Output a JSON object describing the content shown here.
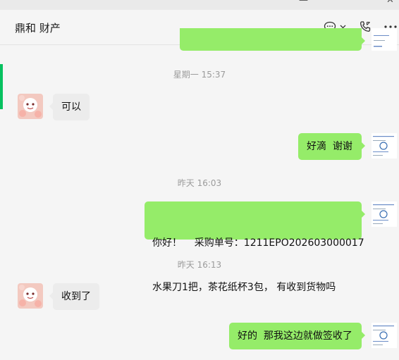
{
  "window": {
    "controls": [
      "—",
      "✕"
    ]
  },
  "header": {
    "title": "鼎和 财产",
    "icons": [
      "chat-bubble-icon",
      "chevron-down-icon",
      "phone-icon",
      "more-icon"
    ]
  },
  "messages": [
    {
      "type": "timestamp",
      "text": "星期一 15:37"
    },
    {
      "type": "received",
      "text": "可以"
    },
    {
      "type": "sent",
      "text": "好滴  谢谢"
    },
    {
      "type": "timestamp",
      "text": "昨天 16:03"
    },
    {
      "type": "sent",
      "line1": "你好！    采购单号：1211EPO202603000017",
      "line2": "水果刀1把，茶花纸杯3包， 有收到货物吗"
    },
    {
      "type": "timestamp",
      "text": "昨天 16:13"
    },
    {
      "type": "received",
      "text": "收到了"
    },
    {
      "type": "sent",
      "text": "好的  那我这边就做签收了"
    }
  ],
  "colors": {
    "sent_bubble": "#95ec69",
    "received_bubble": "#ececec",
    "accent": "#07c160"
  }
}
